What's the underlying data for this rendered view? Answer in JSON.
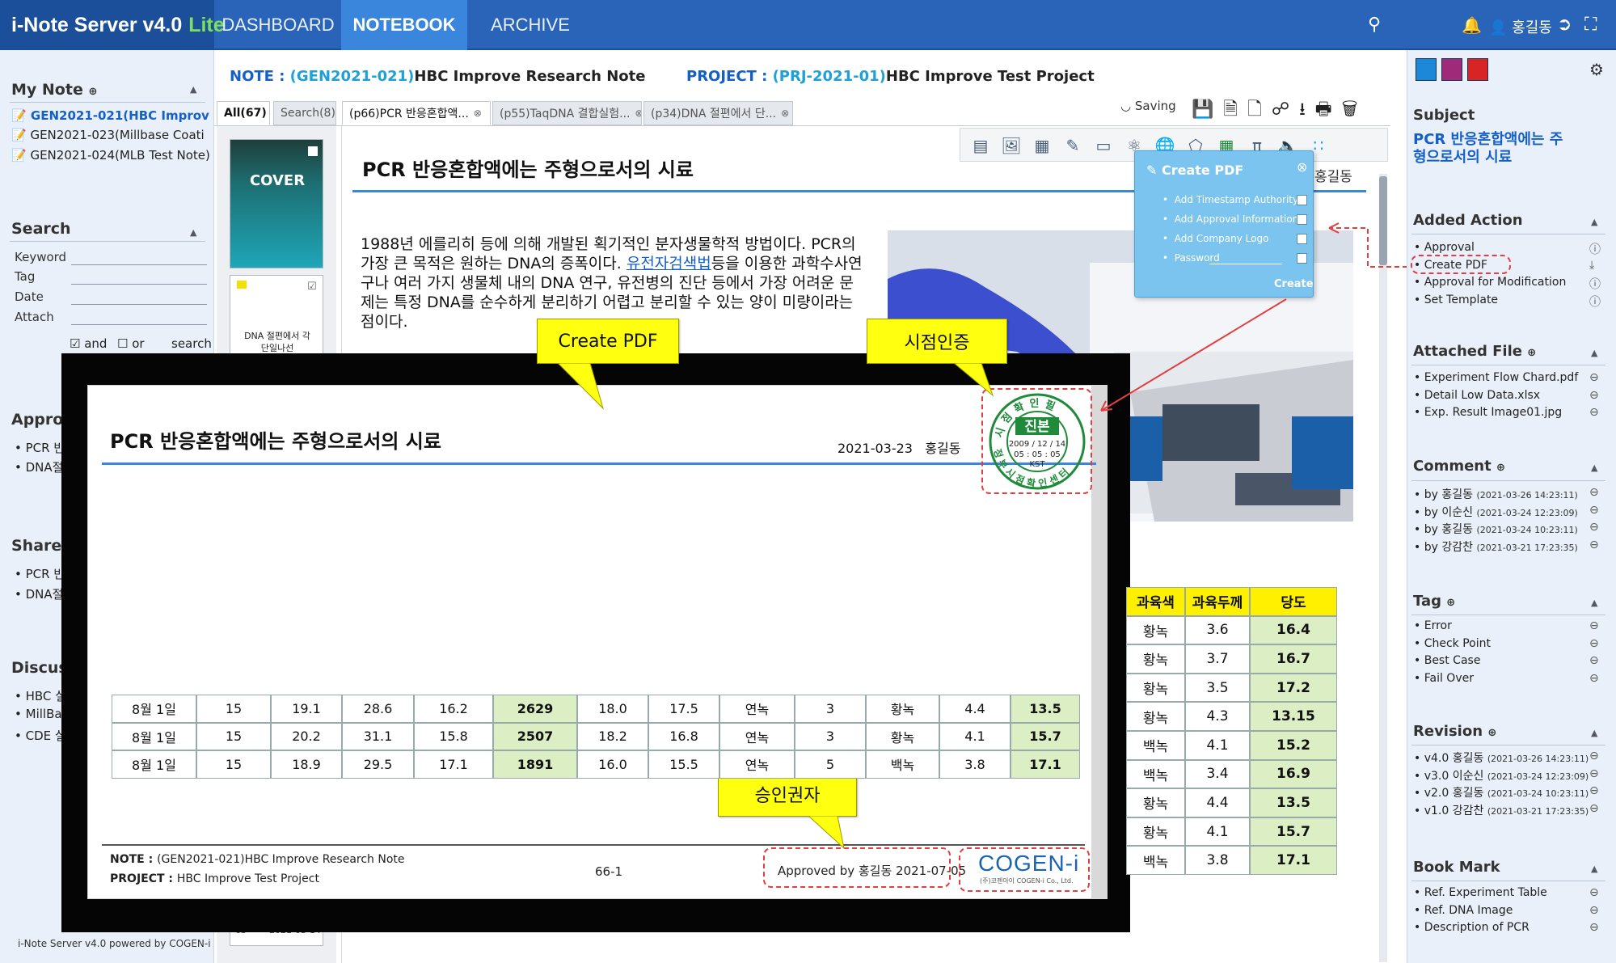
{
  "app": {
    "logo_main": "i-Note Server v4.0",
    "logo_lite": "Lite",
    "nav": [
      "DASHBOARD",
      "NOTEBOOK",
      "ARCHIVE"
    ],
    "user": "홍길동",
    "footer": "i-Note Server v4.0 powered by COGEN-i"
  },
  "left": {
    "my_note_title": "My Note",
    "notes": [
      "GEN2021-021(HBC Improve",
      "GEN2021-023(Millbase Coati",
      "GEN2021-024(MLB Test Note)"
    ],
    "search_title": "Search",
    "search_fields": [
      "Keyword",
      "Tag",
      "Date",
      "Attach"
    ],
    "and_label": "and",
    "or_label": "or",
    "search_button": "search",
    "approval_title": "Approv",
    "approval_items": [
      "PCR 반",
      "DNA절"
    ],
    "shared_title": "Shared",
    "shared_items": [
      "PCR 반",
      "DNA절"
    ],
    "discuss_title": "Discuss",
    "discuss_items": [
      "HBC 실",
      "MillBas",
      "CDE 실"
    ]
  },
  "header": {
    "note_label": "NOTE : ",
    "note_code": "(GEN2021-021)",
    "note_name": "HBC Improve Research Note",
    "project_label": "PROJECT : ",
    "project_code": "(PRJ-2021-01)",
    "project_name": "HBC Improve Test Project",
    "saving": "Saving"
  },
  "tabs": {
    "all": "All(67)",
    "search": "Search(8)",
    "pages": [
      "(p66)PCR 반응혼합액...",
      "(p55)TaqDNA 결합실험...",
      "(p34)DNA 절편에서 단..."
    ]
  },
  "thumbs": {
    "cover": "COVER",
    "page2_line1": "DNA 절편에서 각",
    "page2_line2": "단일나선",
    "bottom_num": "63",
    "bottom_date": "2021-03-14"
  },
  "doc": {
    "title": "PCR 반응혼합액에는 주형으로서의 시료",
    "author_partial": "홍길동",
    "body_before_link": "1988년 에를리히 등에 의해 개발된 획기적인 분자생물학적 방법이다. PCR의 가장 큰 목적은 원하는 DNA의 증폭이다. ",
    "body_link": "유전자검색법",
    "body_after_link": "등을 이용한 과학수사연구나 여러 가지 생물체 내의 DNA 연구, 유전병의 진단 등에서 가장 어려운 문제는 특정 DNA를 순수하게 분리하기 어렵고 분리할 수 있는 양이 미량이라는 점이다.",
    "table_headers": [
      "과육색",
      "과육두께",
      "당도"
    ],
    "table_rows": [
      [
        "황녹",
        "3.6",
        "16.4"
      ],
      [
        "황녹",
        "3.7",
        "16.7"
      ],
      [
        "황녹",
        "3.5",
        "17.2"
      ],
      [
        "황녹",
        "4.3",
        "13.15"
      ],
      [
        "백녹",
        "4.1",
        "15.2"
      ],
      [
        "백녹",
        "3.4",
        "16.9"
      ],
      [
        "황녹",
        "4.4",
        "13.5"
      ],
      [
        "황녹",
        "4.1",
        "15.7"
      ],
      [
        "백녹",
        "3.8",
        "17.1"
      ]
    ]
  },
  "popup": {
    "title": "Create PDF",
    "options": [
      "Add Timestamp Authority",
      "Add Approval Information",
      "Add Company Logo",
      "Password"
    ],
    "create": "Create"
  },
  "pdf": {
    "title": "PCR 반응혼합액에는 주형으로서의 시료",
    "date": "2021-03-23",
    "author": "홍길동",
    "rows": [
      [
        "8월 1일",
        "15",
        "19.1",
        "28.6",
        "16.2",
        "2629",
        "18.0",
        "17.5",
        "연녹",
        "3",
        "황녹",
        "4.4",
        "13.5"
      ],
      [
        "8월 1일",
        "15",
        "20.2",
        "31.1",
        "15.8",
        "2507",
        "18.2",
        "16.8",
        "연녹",
        "3",
        "황녹",
        "4.1",
        "15.7"
      ],
      [
        "8월 1일",
        "15",
        "18.9",
        "29.5",
        "17.1",
        "1891",
        "16.0",
        "15.5",
        "연녹",
        "5",
        "백녹",
        "3.8",
        "17.1"
      ]
    ],
    "footer_note_label": "NOTE : ",
    "footer_note": "(GEN2021-021)HBC Improve Research Note",
    "footer_project_label": "PROJECT : ",
    "footer_project": "HBC Improve Test Project",
    "page_no": "66-1",
    "approved_by": "Approved by 홍길동 2021-07-05",
    "company_logo": "COGEN-i",
    "company_sub": "(주)코젠아이 COGEN-i Co., Ltd."
  },
  "stamp": {
    "top_text": "시점확인필",
    "center": "진본",
    "date": "2009 / 12 / 14",
    "time": "05 : 05 : 05",
    "zone": "KST",
    "bottom_text": "정부시점확인센터"
  },
  "callouts": {
    "create_pdf": "Create PDF",
    "timestamp": "시점인증",
    "approver": "승인권자"
  },
  "right": {
    "subject_title": "Subject",
    "subject": "PCR 반응혼합액에는 주형으로서의 시료",
    "added_action_title": "Added Action",
    "actions": [
      "Approval",
      "Create PDF",
      "Approval for Modification",
      "Set Template"
    ],
    "attached_title": "Attached File",
    "files": [
      "Experiment Flow Chard.pdf",
      "Detail Low Data.xlsx",
      "Exp. Result Image01.jpg"
    ],
    "comment_title": "Comment",
    "comments": [
      {
        "by": "by 홍길동",
        "ts": "(2021-03-26 14:23:11)"
      },
      {
        "by": "by 이순신",
        "ts": "(2021-03-24 12:23:09)"
      },
      {
        "by": "by 홍길동",
        "ts": "(2021-03-24 10:23:11)"
      },
      {
        "by": "by 강감찬",
        "ts": "(2021-03-21 17:23:35)"
      }
    ],
    "tag_title": "Tag",
    "tags": [
      "Error",
      "Check Point",
      "Best Case",
      "Fail Over"
    ],
    "revision_title": "Revision",
    "revisions": [
      {
        "v": "v4.0 홍길동",
        "ts": "(2021-03-26 14:23:11)"
      },
      {
        "v": "v3.0 이순신",
        "ts": "(2021-03-24 12:23:09)"
      },
      {
        "v": "v2.0 홍길동",
        "ts": "(2021-03-24 10:23:11)"
      },
      {
        "v": "v1.0 강감찬",
        "ts": "(2021-03-21 17:23:35)"
      }
    ],
    "bookmark_title": "Book Mark",
    "bookmarks": [
      "Ref. Experiment Table",
      "Ref. DNA Image",
      "Description of PCR"
    ]
  },
  "colors": {
    "topbar": "#2a64b8",
    "accent": "#1560c8",
    "popup": "#7cc4f0",
    "highlight_yellow": "#fff000",
    "cell_green": "#dbeec4",
    "stamp_green": "#1f8a3a",
    "dashed_red": "#e24040"
  }
}
